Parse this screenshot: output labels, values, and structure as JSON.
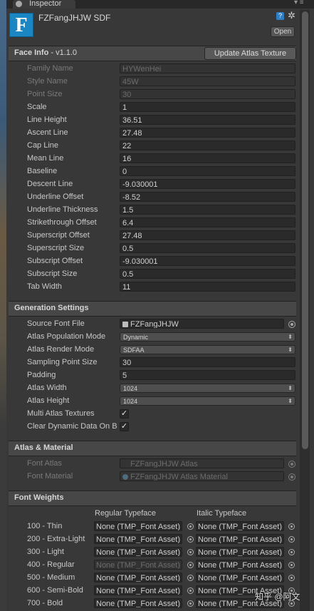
{
  "window": {
    "tab_label": "Inspector",
    "tab_menu": "▾ ≡"
  },
  "asset": {
    "icon_letter": "F",
    "title": "FZFangJHJW SDF",
    "open_label": "Open",
    "help": "?",
    "gear": "✲"
  },
  "face_info": {
    "header": "Face Info",
    "version": " - v1.1.0",
    "update_button": "Update Atlas Texture",
    "rows": [
      {
        "label": "Family Name",
        "value": "HYWenHei",
        "disabled": true
      },
      {
        "label": "Style Name",
        "value": "45W",
        "disabled": true
      },
      {
        "label": "Point Size",
        "value": "30",
        "disabled": true
      },
      {
        "label": "Scale",
        "value": "1"
      },
      {
        "label": "Line Height",
        "value": "36.51"
      },
      {
        "label": "Ascent Line",
        "value": "27.48"
      },
      {
        "label": "Cap Line",
        "value": "22"
      },
      {
        "label": "Mean Line",
        "value": "16"
      },
      {
        "label": "Baseline",
        "value": "0"
      },
      {
        "label": "Descent Line",
        "value": "-9.030001"
      },
      {
        "label": "Underline Offset",
        "value": "-8.52"
      },
      {
        "label": "Underline Thickness",
        "value": "1.5"
      },
      {
        "label": "Strikethrough Offset",
        "value": "6.4"
      },
      {
        "label": "Superscript Offset",
        "value": "27.48"
      },
      {
        "label": "Superscript Size",
        "value": "0.5"
      },
      {
        "label": "Subscript Offset",
        "value": "-9.030001"
      },
      {
        "label": "Subscript Size",
        "value": "0.5"
      },
      {
        "label": "Tab Width",
        "value": "11"
      }
    ]
  },
  "generation": {
    "header": "Generation Settings",
    "source_font_file": {
      "label": "Source Font File",
      "value": "FZFangJHJW"
    },
    "population_mode": {
      "label": "Atlas Population Mode",
      "value": "Dynamic"
    },
    "render_mode": {
      "label": "Atlas Render Mode",
      "value": "SDFAA"
    },
    "sampling": {
      "label": "Sampling Point Size",
      "value": "30"
    },
    "padding": {
      "label": "Padding",
      "value": "5"
    },
    "atlas_width": {
      "label": "Atlas Width",
      "value": "1024"
    },
    "atlas_height": {
      "label": "Atlas Height",
      "value": "1024"
    },
    "multi_atlas": {
      "label": "Multi Atlas Textures",
      "checked": "✓"
    },
    "clear_dynamic": {
      "label": "Clear Dynamic Data On B",
      "checked": "✓"
    }
  },
  "atlas_material": {
    "header": "Atlas & Material",
    "font_atlas": {
      "label": "Font Atlas",
      "value": "FZFangJHJW Atlas"
    },
    "font_material": {
      "label": "Font Material",
      "value": "FZFangJHJW Atlas Material"
    }
  },
  "font_weights": {
    "header": "Font Weights",
    "regular_header": "Regular Typeface",
    "italic_header": "Italic Typeface",
    "rows": [
      {
        "label": "100 - Thin",
        "regular": "None (TMP_Font Asset)",
        "italic": "None (TMP_Font Asset)"
      },
      {
        "label": "200 - Extra-Light",
        "regular": "None (TMP_Font Asset)",
        "italic": "None (TMP_Font Asset)"
      },
      {
        "label": "300 - Light",
        "regular": "None (TMP_Font Asset)",
        "italic": "None (TMP_Font Asset)"
      },
      {
        "label": "400 - Regular",
        "regular": "None (TMP_Font Asset)",
        "italic": "None (TMP_Font Asset)",
        "regular_disabled": true
      },
      {
        "label": "500 - Medium",
        "regular": "None (TMP_Font Asset)",
        "italic": "None (TMP_Font Asset)"
      },
      {
        "label": "600 - Semi-Bold",
        "regular": "None (TMP_Font Asset)",
        "italic": "None (TMP_Font Asset)"
      },
      {
        "label": "700 - Bold",
        "regular": "None (TMP_Font Asset)",
        "italic": "None (TMP_Font Asset)"
      }
    ]
  },
  "watermark": "知乎 @阿文"
}
